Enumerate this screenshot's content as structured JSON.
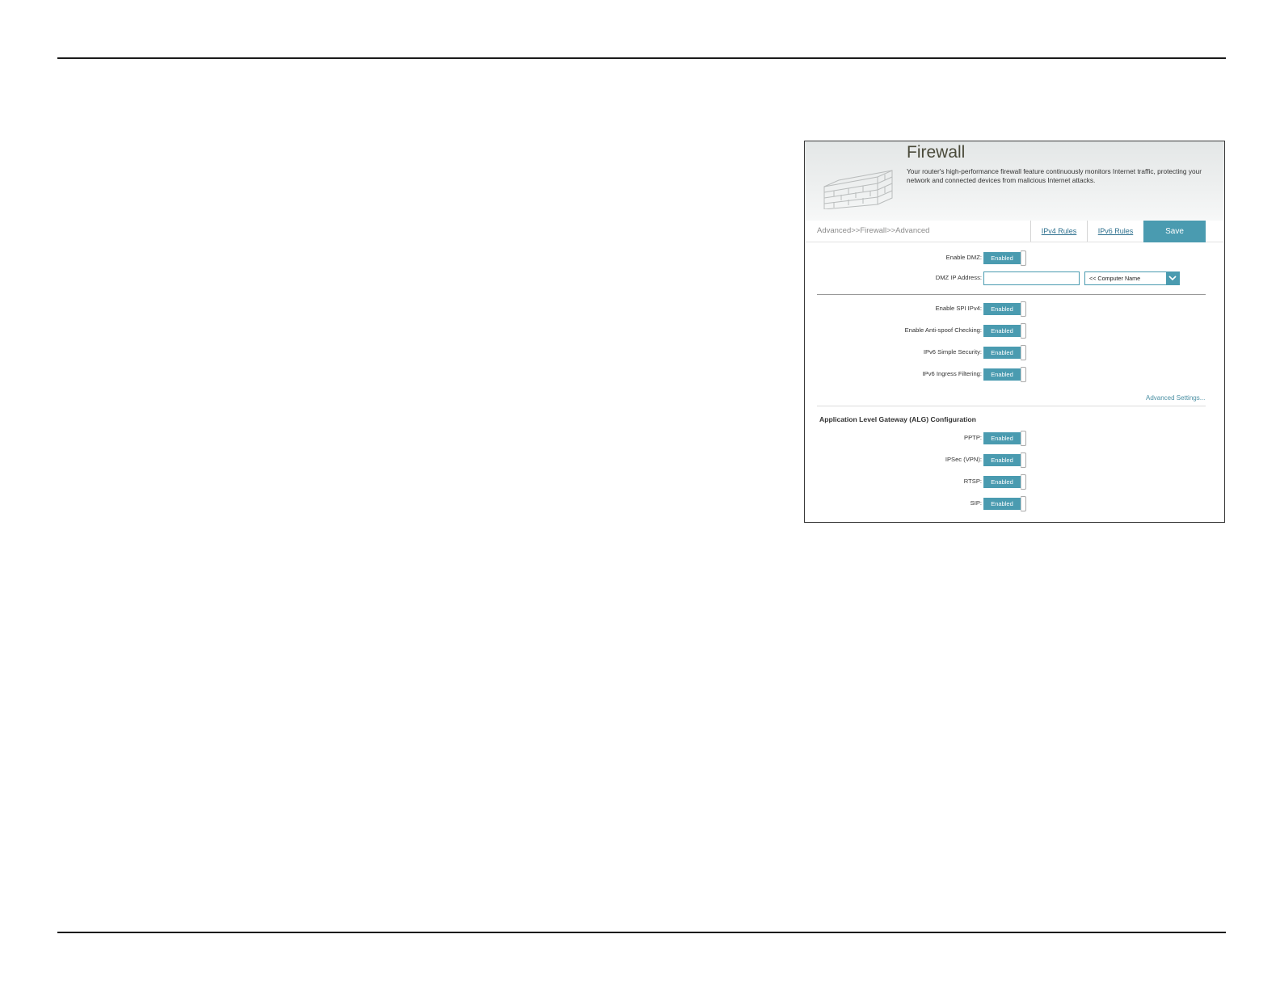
{
  "panel": {
    "title": "Firewall",
    "description": "Your router's high-performance firewall feature continuously monitors Internet traffic, protecting your network and connected devices from malicious Internet attacks.",
    "icon": "brick-wall-icon"
  },
  "nav": {
    "breadcrumb": "Advanced>>Firewall>>Advanced",
    "tab_ipv4": "IPv4 Rules",
    "tab_ipv6": "IPv6 Rules",
    "save_label": "Save"
  },
  "dmz": {
    "enable_label": "Enable DMZ:",
    "enable_value": "Enabled",
    "ip_label": "DMZ IP Address:",
    "ip_value": "",
    "computer_select": "<< Computer Name"
  },
  "security": [
    {
      "label": "Enable SPI IPv4:",
      "value": "Enabled"
    },
    {
      "label": "Enable Anti-spoof Checking:",
      "value": "Enabled"
    },
    {
      "label": "IPv6 Simple Security:",
      "value": "Enabled"
    },
    {
      "label": "IPv6 Ingress Filtering:",
      "value": "Enabled"
    }
  ],
  "advanced_settings_link": "Advanced Settings...",
  "alg": {
    "title": "Application Level Gateway (ALG) Configuration",
    "items": [
      {
        "label": "PPTP:",
        "value": "Enabled"
      },
      {
        "label": "IPSec (VPN):",
        "value": "Enabled"
      },
      {
        "label": "RTSP:",
        "value": "Enabled"
      },
      {
        "label": "SIP:",
        "value": "Enabled"
      }
    ]
  },
  "colors": {
    "accent": "#4a9bb0",
    "link": "#2c6f8d"
  }
}
